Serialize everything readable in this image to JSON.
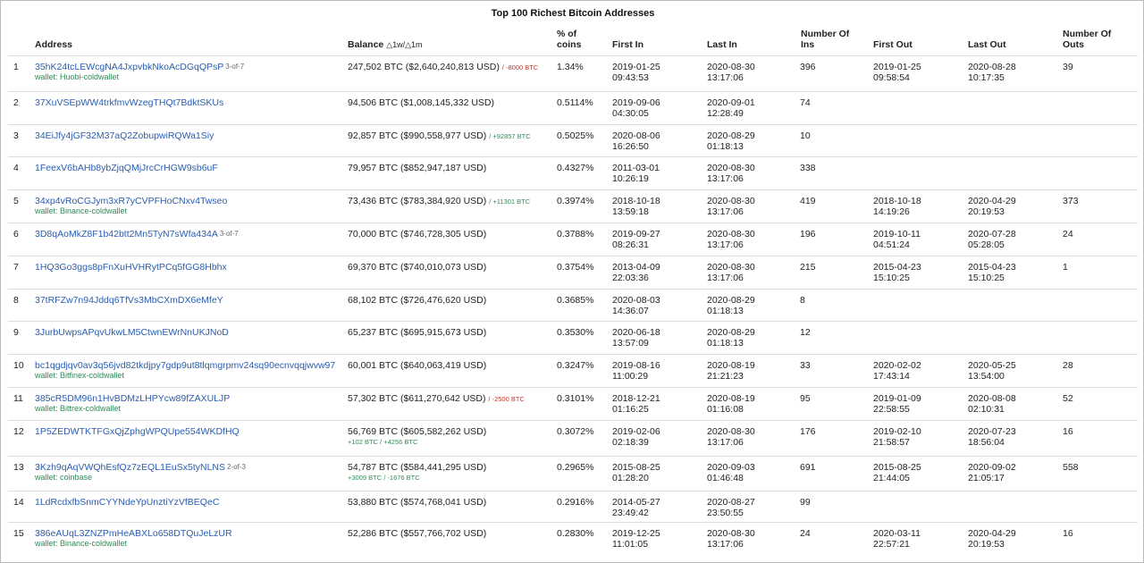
{
  "title": "Top 100 Richest Bitcoin Addresses",
  "headers": {
    "address": "Address",
    "balance": "Balance",
    "balance_sub": "△1w/△1m",
    "pct": [
      "% of",
      "coins"
    ],
    "first_in": "First In",
    "last_in": "Last In",
    "ins": [
      "Number Of",
      "Ins"
    ],
    "first_out": "First Out",
    "last_out": "Last Out",
    "outs": [
      "Number Of",
      "Outs"
    ]
  },
  "rows": [
    {
      "n": "1",
      "addr": "35hK24tcLEWcgNA4JxpvbkNkoAcDGqQPsP",
      "tag": "3-of-7",
      "wallet": "wallet: Huobi-coldwallet",
      "bal": "247,502 BTC ($2,640,240,813 USD)",
      "chg": "/ -8000 BTC",
      "chg_type": "neg",
      "extra": "",
      "pct": "1.34%",
      "fi1": "2019-01-25",
      "fi2": "09:43:53",
      "li1": "2020-08-30",
      "li2": "13:17:06",
      "ins": "396",
      "fo1": "2019-01-25",
      "fo2": "09:58:54",
      "lo1": "2020-08-28",
      "lo2": "10:17:35",
      "outs": "39",
      "balw": 1.0,
      "pctw": 0.45,
      "fiw": 0.8,
      "liw": 0.0,
      "fow": 0.8,
      "low": 0.8
    },
    {
      "n": "2",
      "addr": "37XuVSEpWW4trkfmvWzegTHQt7BdktSKUs",
      "tag": "",
      "wallet": "",
      "bal": "94,506 BTC ($1,008,145,332 USD)",
      "chg": "",
      "chg_type": "",
      "extra": "",
      "pct": "0.5114%",
      "fi1": "2019-09-06",
      "fi2": "04:30:05",
      "li1": "2020-09-01",
      "li2": "12:28:49",
      "ins": "74",
      "fo1": "",
      "fo2": "",
      "lo1": "",
      "lo2": "",
      "outs": "",
      "balw": 0.24,
      "pctw": 0.3,
      "fiw": 0.85,
      "liw": 0.85,
      "fow": 0,
      "low": 0
    },
    {
      "n": "3",
      "addr": "34EiJfy4jGF32M37aQ2ZobupwiRQWa1Siy",
      "tag": "",
      "wallet": "",
      "bal": "92,857 BTC ($990,558,977 USD)",
      "chg": "/ +92857 BTC",
      "chg_type": "pos",
      "extra": "",
      "pct": "0.5025%",
      "fi1": "2020-08-06",
      "fi2": "16:26:50",
      "li1": "2020-08-29",
      "li2": "01:18:13",
      "ins": "10",
      "fo1": "",
      "fo2": "",
      "lo1": "",
      "lo2": "",
      "outs": "",
      "balw": 0.24,
      "pctw": 0.3,
      "fiw": 0.95,
      "liw": 0.0,
      "fow": 0,
      "low": 0
    },
    {
      "n": "4",
      "addr": "1FeexV6bAHb8ybZjqQMjJrcCrHGW9sb6uF",
      "tag": "",
      "wallet": "",
      "bal": "79,957 BTC ($852,947,187 USD)",
      "chg": "",
      "chg_type": "",
      "extra": "",
      "pct": "0.4327%",
      "fi1": "2011-03-01",
      "fi2": "10:26:19",
      "li1": "2020-08-30",
      "li2": "13:17:06",
      "ins": "338",
      "fo1": "",
      "fo2": "",
      "lo1": "",
      "lo2": "",
      "outs": "",
      "balw": 0.24,
      "pctw": 0.3,
      "fiw": 0.0,
      "liw": 0.0,
      "fow": 0,
      "low": 0
    },
    {
      "n": "5",
      "addr": "34xp4vRoCGJym3xR7yCVPFHoCNxv4Twseo",
      "tag": "",
      "wallet": "wallet: Binance-coldwallet",
      "bal": "73,436 BTC ($783,384,920 USD)",
      "chg": "/ +11301 BTC",
      "chg_type": "pos",
      "extra": "",
      "pct": "0.3974%",
      "fi1": "2018-10-18",
      "fi2": "13:59:18",
      "li1": "2020-08-30",
      "li2": "13:17:06",
      "ins": "419",
      "fo1": "2018-10-18",
      "fo2": "14:19:26",
      "lo1": "2020-04-29",
      "lo2": "20:19:53",
      "outs": "373",
      "balw": 0.24,
      "pctw": 0.3,
      "fiw": 0.75,
      "liw": 0.0,
      "fow": 0.8,
      "low": 0.9
    },
    {
      "n": "6",
      "addr": "3D8qAoMkZ8F1b42btt2Mn5TyN7sWfa434A",
      "tag": "3-of-7",
      "wallet": "",
      "bal": "70,000 BTC ($746,728,305 USD)",
      "chg": "",
      "chg_type": "",
      "extra": "",
      "pct": "0.3788%",
      "fi1": "2019-09-27",
      "fi2": "08:26:31",
      "li1": "2020-08-30",
      "li2": "13:17:06",
      "ins": "196",
      "fo1": "2019-10-11",
      "fo2": "04:51:24",
      "lo1": "2020-07-28",
      "lo2": "05:28:05",
      "outs": "24",
      "balw": 0.24,
      "pctw": 0.3,
      "fiw": 0.85,
      "liw": 0.0,
      "fow": 0.85,
      "low": 0.5
    },
    {
      "n": "7",
      "addr": "1HQ3Go3ggs8pFnXuHVHRytPCq5fGG8Hbhx",
      "tag": "",
      "wallet": "",
      "bal": "69,370 BTC ($740,010,073 USD)",
      "chg": "",
      "chg_type": "",
      "extra": "",
      "pct": "0.3754%",
      "fi1": "2013-04-09",
      "fi2": "22:03:36",
      "li1": "2020-08-30",
      "li2": "13:17:06",
      "ins": "215",
      "fo1": "2015-04-23",
      "fo2": "15:10:25",
      "lo1": "2015-04-23",
      "lo2": "15:10:25",
      "outs": "1",
      "balw": 0.24,
      "pctw": 0.3,
      "fiw": 0.0,
      "liw": 0.0,
      "fow": 0.0,
      "low": 0.0
    },
    {
      "n": "8",
      "addr": "37tRFZw7n94Jddq6TfVs3MbCXmDX6eMfeY",
      "tag": "",
      "wallet": "",
      "bal": "68,102 BTC ($726,476,620 USD)",
      "chg": "",
      "chg_type": "",
      "extra": "",
      "pct": "0.3685%",
      "fi1": "2020-08-03",
      "fi2": "14:36:07",
      "li1": "2020-08-29",
      "li2": "01:18:13",
      "ins": "8",
      "fo1": "",
      "fo2": "",
      "lo1": "",
      "lo2": "",
      "outs": "",
      "balw": 0.24,
      "pctw": 0.3,
      "fiw": 0.95,
      "liw": 0.0,
      "fow": 0,
      "low": 0
    },
    {
      "n": "9",
      "addr": "3JurbUwpsAPqvUkwLM5CtwnEWrNnUKJNoD",
      "tag": "",
      "wallet": "",
      "bal": "65,237 BTC ($695,915,673 USD)",
      "chg": "",
      "chg_type": "",
      "extra": "",
      "pct": "0.3530%",
      "fi1": "2020-06-18",
      "fi2": "13:57:09",
      "li1": "2020-08-29",
      "li2": "01:18:13",
      "ins": "12",
      "fo1": "",
      "fo2": "",
      "lo1": "",
      "lo2": "",
      "outs": "",
      "balw": 0.24,
      "pctw": 0.3,
      "fiw": 0.0,
      "liw": 0.0,
      "fow": 0,
      "low": 0
    },
    {
      "n": "10",
      "addr": "bc1qgdjqv0av3q56jvd82tkdjpy7gdp9ut8tlqmgrpmv24sq90ecnvqqjwvw97",
      "tag": "",
      "wallet": "wallet: Bitfinex-coldwallet",
      "bal": "60,001 BTC ($640,063,419 USD)",
      "chg": "",
      "chg_type": "",
      "extra": "",
      "pct": "0.3247%",
      "fi1": "2019-08-16",
      "fi2": "11:00:29",
      "li1": "2020-08-19",
      "li2": "21:21:23",
      "ins": "33",
      "fo1": "2020-02-02",
      "fo2": "17:43:14",
      "lo1": "2020-05-25",
      "lo2": "13:54:00",
      "outs": "28",
      "balw": 0.24,
      "pctw": 0.3,
      "fiw": 0.85,
      "liw": 0.0,
      "fow": 0.85,
      "low": 0.85
    },
    {
      "n": "11",
      "addr": "385cR5DM96n1HvBDMzLHPYcw89fZAXULJP",
      "tag": "",
      "wallet": "wallet: Bittrex-coldwallet",
      "bal": "57,302 BTC ($611,270,642 USD)",
      "chg": "/ -2500 BTC",
      "chg_type": "neg",
      "extra": "",
      "pct": "0.3101%",
      "fi1": "2018-12-21",
      "fi2": "01:16:25",
      "li1": "2020-08-19",
      "li2": "01:16:08",
      "ins": "95",
      "fo1": "2019-01-09",
      "fo2": "22:58:55",
      "lo1": "2020-08-08",
      "lo2": "02:10:31",
      "outs": "52",
      "balw": 0.24,
      "pctw": 0.3,
      "fiw": 0.0,
      "liw": 0.0,
      "fow": 0.85,
      "low": 0.0
    },
    {
      "n": "12",
      "addr": "1P5ZEDWTKTFGxQjZphgWPQUpe554WKDfHQ",
      "tag": "",
      "wallet": "",
      "bal": "56,769 BTC ($605,582,262 USD)",
      "chg": "",
      "chg_type": "",
      "extra": "+102 BTC / +4256 BTC",
      "pct": "0.3072%",
      "fi1": "2019-02-06",
      "fi2": "02:18:39",
      "li1": "2020-08-30",
      "li2": "13:17:06",
      "ins": "176",
      "fo1": "2019-02-10",
      "fo2": "21:58:57",
      "lo1": "2020-07-23",
      "lo2": "18:56:04",
      "outs": "16",
      "balw": 0.24,
      "pctw": 0.3,
      "fiw": 0.0,
      "liw": 0.0,
      "fow": 0.85,
      "low": 0.85
    },
    {
      "n": "13",
      "addr": "3Kzh9qAqVWQhEsfQz7zEQL1EuSx5tyNLNS",
      "tag": "2-of-3",
      "wallet": "wallet: coinbase",
      "bal": "54,787 BTC ($584,441,295 USD)",
      "chg": "",
      "chg_type": "",
      "extra": "+3009 BTC / -1676 BTC",
      "pct": "0.2965%",
      "fi1": "2015-08-25",
      "fi2": "01:28:20",
      "li1": "2020-09-03",
      "li2": "01:46:48",
      "ins": "691",
      "fo1": "2015-08-25",
      "fo2": "21:44:05",
      "lo1": "2020-09-02",
      "lo2": "21:05:17",
      "outs": "558",
      "balw": 0.24,
      "pctw": 0.3,
      "fiw": 0.0,
      "liw": 0.0,
      "fow": 0.0,
      "low": 0.85
    },
    {
      "n": "14",
      "addr": "1LdRcdxfbSnmCYYNdeYpUnztiYzVfBEQeC",
      "tag": "",
      "wallet": "",
      "bal": "53,880 BTC ($574,768,041 USD)",
      "chg": "",
      "chg_type": "",
      "extra": "",
      "pct": "0.2916%",
      "fi1": "2014-05-27",
      "fi2": "23:49:42",
      "li1": "2020-08-27",
      "li2": "23:50:55",
      "ins": "99",
      "fo1": "",
      "fo2": "",
      "lo1": "",
      "lo2": "",
      "outs": "",
      "balw": 0.24,
      "pctw": 0.3,
      "fiw": 0.0,
      "liw": 0.0,
      "fow": 0,
      "low": 0
    },
    {
      "n": "15",
      "addr": "386eAUqL3ZNZPmHeABXLo658DTQuJeLzUR",
      "tag": "",
      "wallet": "wallet: Binance-coldwallet",
      "bal": "52,286 BTC ($557,766,702 USD)",
      "chg": "",
      "chg_type": "",
      "extra": "",
      "pct": "0.2830%",
      "fi1": "2019-12-25",
      "fi2": "11:01:05",
      "li1": "2020-08-30",
      "li2": "13:17:06",
      "ins": "24",
      "fo1": "2020-03-11",
      "fo2": "22:57:21",
      "lo1": "2020-04-29",
      "lo2": "20:19:53",
      "outs": "16",
      "balw": 0.24,
      "pctw": 0.3,
      "fiw": 0.85,
      "liw": 0.0,
      "fow": 0.85,
      "low": 0.85
    }
  ]
}
